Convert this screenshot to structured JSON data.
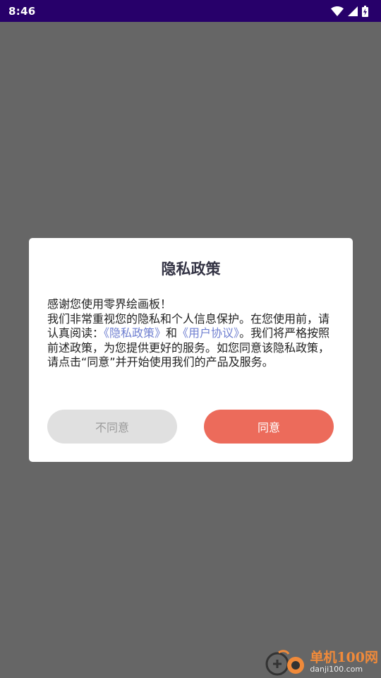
{
  "status_bar": {
    "time": "8:46",
    "icons": [
      "wifi-icon",
      "cell-signal-icon",
      "battery-icon"
    ],
    "background": "#27006a"
  },
  "dialog": {
    "title": "隐私政策",
    "body": {
      "greeting": "感谢您使用零界绘画板！",
      "line_intro": "我们非常重视您的隐私和个人信息保护。在您使用前，请认真阅读：",
      "privacy_link": "《隐私政策》",
      "and_text": "和",
      "user_agreement_link": "《用户协议》",
      "line_rest": "。我们将严格按照前述政策，为您提供更好的服务。如您同意该隐私政策，请点击“同意”并开始使用我们的产品及服务。"
    },
    "buttons": {
      "disagree": "不同意",
      "agree": "同意"
    },
    "colors": {
      "link": "#6f7fd0",
      "agree_button": "#ec6b5b",
      "disagree_button": "#e0e0e0"
    }
  },
  "watermark": {
    "name": "单机100网",
    "domain": "danji100.com"
  }
}
